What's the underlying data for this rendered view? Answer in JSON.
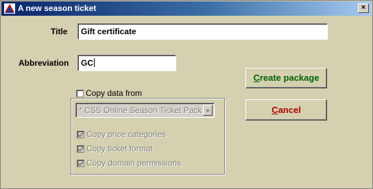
{
  "window": {
    "title": "A new season ticket",
    "close_symbol": "×"
  },
  "form": {
    "title_label": "Title",
    "title_value": "Gift certificate",
    "abbreviation_label": "Abbreviation",
    "abbreviation_value": "GC",
    "copy_data_from_label": "Copy data from",
    "copy_data_from_checked": false,
    "source_package_selected": "* CSS Online Season Ticket Pack",
    "copy_options": [
      {
        "label": "Copy price categories",
        "checked": true,
        "enabled": false
      },
      {
        "label": "Copy ticket format",
        "checked": true,
        "enabled": false
      },
      {
        "label": "Copy domain permissions",
        "checked": true,
        "enabled": false
      }
    ]
  },
  "buttons": {
    "create_package": {
      "mnemonic": "C",
      "rest": "reate package",
      "color": "#006400"
    },
    "cancel": {
      "mnemonic": "C",
      "rest": "ancel",
      "color": "#aa0000"
    }
  }
}
